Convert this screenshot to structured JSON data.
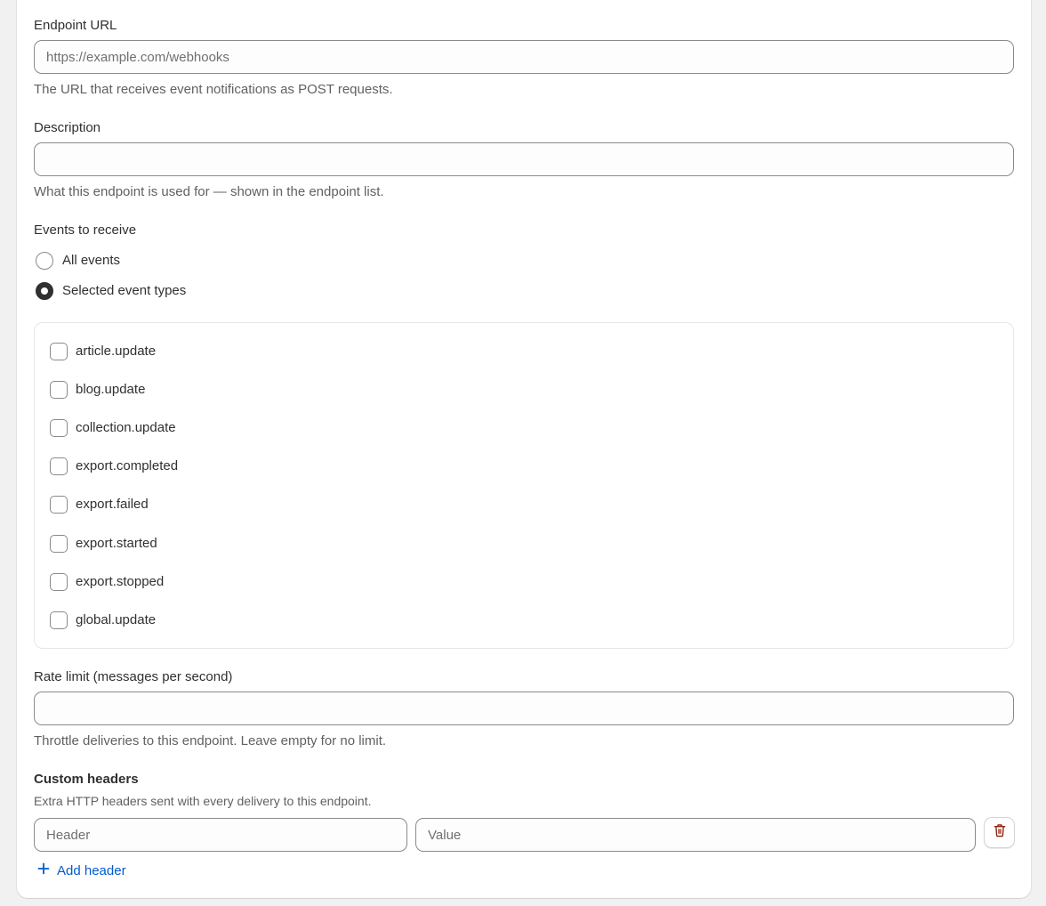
{
  "endpoint_url": {
    "label": "Endpoint URL",
    "placeholder": "https://example.com/webhooks",
    "value": "",
    "help": "The URL that receives event notifications as POST requests."
  },
  "description": {
    "label": "Description",
    "placeholder": "",
    "value": "",
    "help": "What this endpoint is used for — shown in the endpoint list."
  },
  "events": {
    "label": "Events to receive",
    "options": [
      {
        "label": "All events",
        "selected": false
      },
      {
        "label": "Selected event types",
        "selected": true
      }
    ],
    "event_types": [
      {
        "label": "article.update",
        "checked": false
      },
      {
        "label": "blog.update",
        "checked": false
      },
      {
        "label": "collection.update",
        "checked": false
      },
      {
        "label": "export.completed",
        "checked": false
      },
      {
        "label": "export.failed",
        "checked": false
      },
      {
        "label": "export.started",
        "checked": false
      },
      {
        "label": "export.stopped",
        "checked": false
      },
      {
        "label": "global.update",
        "checked": false
      }
    ]
  },
  "rate_limit": {
    "label": "Rate limit (messages per second)",
    "placeholder": "",
    "value": "",
    "help": "Throttle deliveries to this endpoint. Leave empty for no limit."
  },
  "custom_headers": {
    "heading": "Custom headers",
    "help": "Extra HTTP headers sent with every delivery to this endpoint.",
    "header_placeholder": "Header",
    "value_placeholder": "Value",
    "add_label": "Add header"
  },
  "colors": {
    "link": "#005bd3",
    "danger": "#8e1f0b",
    "text": "#303030",
    "muted": "#616161"
  },
  "icons": {
    "delete": "trash-icon",
    "add": "plus-icon"
  }
}
